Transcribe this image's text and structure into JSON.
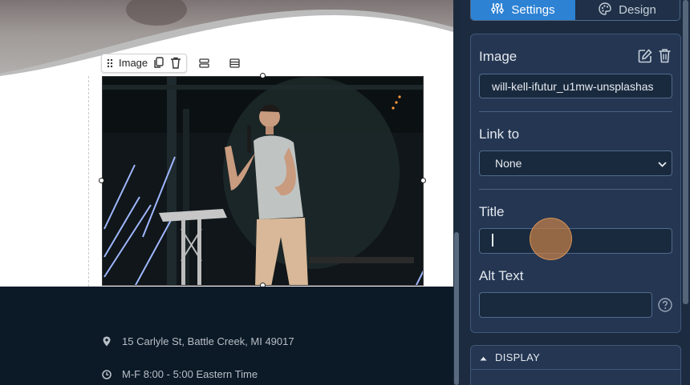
{
  "canvas": {
    "block_toolbar": {
      "label": "Image"
    },
    "footer": {
      "address": "15 Carlyle St, Battle Creek, MI 49017",
      "hours": "M-F 8:00 - 5:00 Eastern Time"
    }
  },
  "panel": {
    "tabs": [
      {
        "label": "Settings",
        "icon": "sliders-icon",
        "active": true
      },
      {
        "label": "Design",
        "icon": "palette-icon",
        "active": false
      }
    ],
    "image": {
      "title": "Image",
      "filename": "will-kell-ifutur_u1mw-unsplashas"
    },
    "link_to": {
      "label": "Link to",
      "selected": "None"
    },
    "title_field": {
      "label": "Title",
      "value": ""
    },
    "alt_text": {
      "label": "Alt Text",
      "value": "",
      "help_icon": "question-circle-icon"
    },
    "display": {
      "label": "DISPLAY"
    }
  },
  "colors": {
    "accent": "#2d82d4",
    "panel_bg": "#1c2b3f",
    "card_bg": "#243652",
    "footer_bg": "#0c1a28",
    "cursor": "#c48048"
  }
}
